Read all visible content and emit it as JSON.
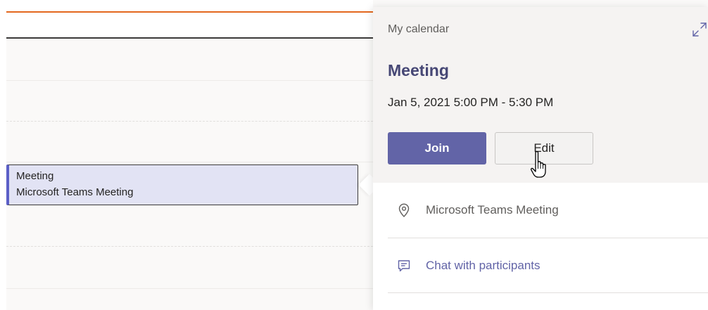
{
  "calendar_event": {
    "title": "Meeting",
    "subtitle": "Microsoft Teams Meeting"
  },
  "popover": {
    "calendar_name": "My calendar",
    "expand_icon": "expand-icon",
    "meeting_title": "Meeting",
    "datetime": "Jan 5, 2021 5:00 PM - 5:30 PM",
    "join_label": "Join",
    "edit_label": "Edit",
    "location_icon": "location-pin-icon",
    "location": "Microsoft Teams Meeting",
    "chat_icon": "chat-icon",
    "chat_label": "Chat with participants"
  },
  "colors": {
    "brand": "#6264a7",
    "title": "#464775",
    "now_line": "#e3681e",
    "event_fill": "#e2e3f4"
  }
}
